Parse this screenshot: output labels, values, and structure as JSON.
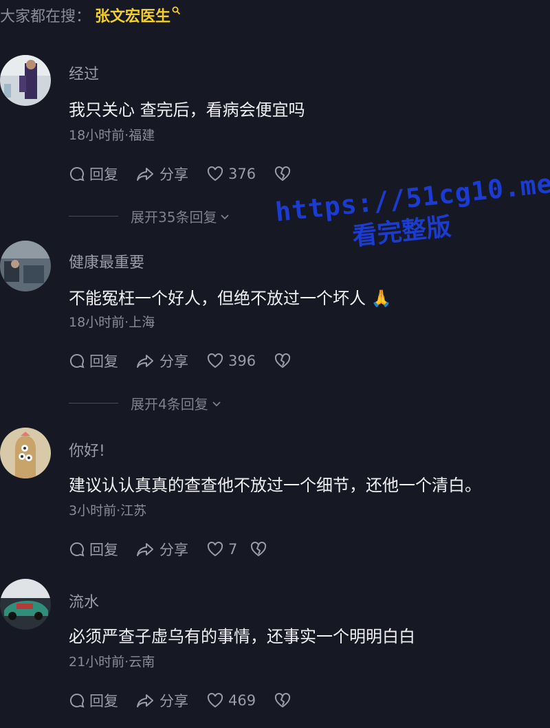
{
  "search_bar": {
    "prefix": "大家都在搜：",
    "term": "张文宏医生",
    "icon": "search-icon"
  },
  "actions_labels": {
    "reply": "回复",
    "share": "分享"
  },
  "comments": [
    {
      "username": "经过",
      "content": "我只关心 查完后，看病会便宜吗",
      "time_location": "18小时前·福建",
      "likes": "376",
      "expand_label": "展开35条回复"
    },
    {
      "username": "健康最重要",
      "content": "不能冤枉一个好人，但绝不放过一个坏人 🙏",
      "time_location": "18小时前·上海",
      "likes": "396",
      "expand_label": "展开4条回复"
    },
    {
      "username": "你好!",
      "content": "建议认认真真的查查他不放过一个细节，还他一个清白。",
      "time_location": "3小时前·江苏",
      "likes": "7"
    },
    {
      "username": "流水",
      "content": "必须严查子虚乌有的事情，还事实一个明明白白",
      "time_location": "21小时前·云南",
      "likes": "469"
    }
  ],
  "watermark": {
    "line1": "https://51cg10.me",
    "line2": "看完整版",
    "color": "#1c3bd0"
  },
  "colors": {
    "background": "#161824",
    "highlight": "#f2cf2c"
  }
}
